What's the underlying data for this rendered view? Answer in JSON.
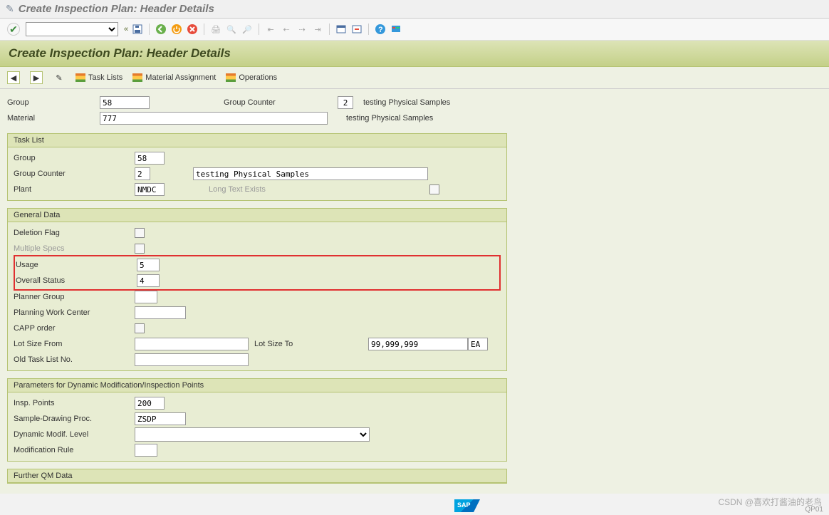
{
  "window": {
    "title": "Create Inspection Plan: Header Details"
  },
  "header": {
    "title": "Create Inspection Plan: Header Details"
  },
  "nav": {
    "task_lists": "Task Lists",
    "material_assignment": "Material Assignment",
    "operations": "Operations"
  },
  "top": {
    "group_lbl": "Group",
    "group_val": "58",
    "group_counter_lbl": "Group Counter",
    "group_counter_val": "2",
    "group_counter_text": "testing Physical Samples",
    "material_lbl": "Material",
    "material_val": "777",
    "material_text": "testing Physical Samples"
  },
  "task_list": {
    "title": "Task List",
    "group_lbl": "Group",
    "group_val": "58",
    "group_counter_lbl": "Group Counter",
    "group_counter_val": "2",
    "group_counter_desc": "testing Physical Samples",
    "plant_lbl": "Plant",
    "plant_val": "NMDC",
    "long_text_lbl": "Long Text Exists"
  },
  "general": {
    "title": "General Data",
    "deletion_flag_lbl": "Deletion Flag",
    "multiple_specs_lbl": "Multiple Specs",
    "usage_lbl": "Usage",
    "usage_val": "5",
    "overall_status_lbl": "Overall Status",
    "overall_status_val": "4",
    "planner_group_lbl": "Planner Group",
    "planner_group_val": "",
    "pwc_lbl": "Planning Work Center",
    "pwc_val": "",
    "capp_lbl": "CAPP order",
    "lot_from_lbl": "Lot Size From",
    "lot_from_val": "",
    "lot_to_lbl": "Lot Size To",
    "lot_to_val": "99,999,999",
    "lot_unit": "EA",
    "old_task_lbl": "Old Task List No.",
    "old_task_val": ""
  },
  "params": {
    "title": "Parameters for Dynamic Modification/Inspection Points",
    "insp_points_lbl": "Insp. Points",
    "insp_points_val": "200",
    "sdp_lbl": "Sample-Drawing Proc.",
    "sdp_val": "ZSDP",
    "dml_lbl": "Dynamic Modif. Level",
    "dml_val": "",
    "mod_rule_lbl": "Modification Rule",
    "mod_rule_val": ""
  },
  "further": {
    "title": "Further QM Data"
  },
  "watermark": "CSDN @喜欢打酱油的老鸟",
  "tcode": "QP01"
}
